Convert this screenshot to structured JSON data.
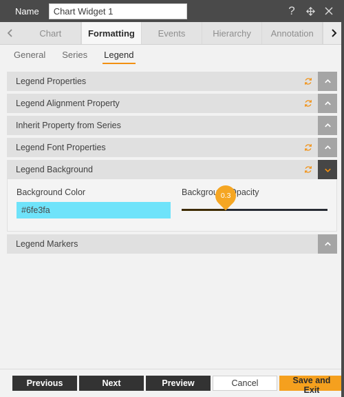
{
  "titlebar": {
    "name_label": "Name",
    "name_value": "Chart Widget 1",
    "name_placeholder": "Name",
    "icons": [
      "help-icon",
      "move-icon",
      "close-icon"
    ],
    "help_glyph": "?",
    "background_color": "#4a4a4a"
  },
  "tabstrip": {
    "prev_arrow": "chevron-left-icon",
    "next_arrow": "chevron-right-icon",
    "tabs": [
      {
        "label": "Chart",
        "active": false
      },
      {
        "label": "Formatting",
        "active": true
      },
      {
        "label": "Events",
        "active": false
      },
      {
        "label": "Hierarchy",
        "active": false
      },
      {
        "label": "Annotation",
        "active": false
      }
    ]
  },
  "subtabs": {
    "items": [
      {
        "label": "General",
        "active": false
      },
      {
        "label": "Series",
        "active": false
      },
      {
        "label": "Legend",
        "active": true
      }
    ],
    "active_underline_color": "#f29011"
  },
  "sections": [
    {
      "title": "Legend Properties",
      "reset": true,
      "expanded": false
    },
    {
      "title": "Legend Alignment Property",
      "reset": true,
      "expanded": false
    },
    {
      "title": "Inherit Property from Series",
      "reset": false,
      "expanded": false
    },
    {
      "title": "Legend Font Properties",
      "reset": true,
      "expanded": false
    },
    {
      "title": "Legend Background",
      "reset": true,
      "expanded": true
    },
    {
      "title": "Legend Markers",
      "reset": false,
      "expanded": false
    }
  ],
  "legend_background": {
    "color_label": "Background Color",
    "color_value": "#6fe3fa",
    "color_placeholder": "#000000",
    "color_swatch": "#6fe3fa",
    "opacity_label": "Background Opacity",
    "opacity_value": "0.3",
    "opacity_percent": 30,
    "track_color": "#272b33",
    "fill_color": "#3d2a00",
    "pin_color": "#f5a623"
  },
  "footer": {
    "buttons": [
      {
        "label": "Previous",
        "style": "dark"
      },
      {
        "label": "Next",
        "style": "dark"
      },
      {
        "label": "Preview",
        "style": "dark"
      },
      {
        "label": "Cancel",
        "style": "light"
      },
      {
        "label": "Save and Exit",
        "style": "accent"
      }
    ],
    "accent_color": "#f5a01e"
  }
}
